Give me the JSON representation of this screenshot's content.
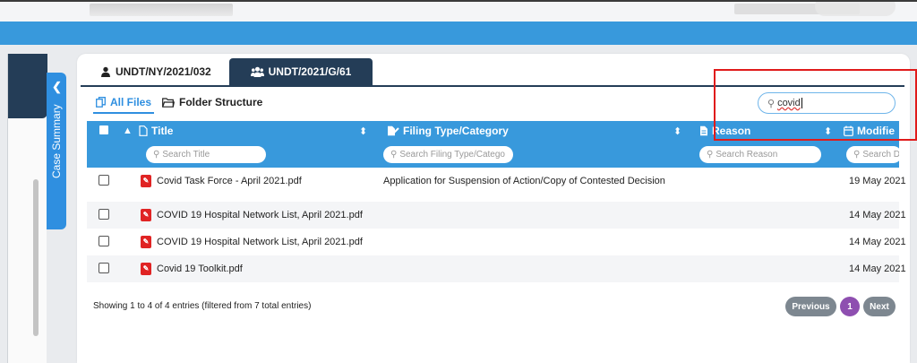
{
  "tabs": [
    {
      "label": "UNDT/NY/2021/032",
      "icon": "user-icon"
    },
    {
      "label": "UNDT/2021/G/61",
      "icon": "users-icon"
    }
  ],
  "side_panel": {
    "collapse_icon": "chevron-left-icon",
    "label": "Case Summary"
  },
  "subtabs": [
    {
      "label": "All Files",
      "icon": "copy-icon"
    },
    {
      "label": "Folder Structure",
      "icon": "folder-icon"
    }
  ],
  "global_search": {
    "value": "covid",
    "icon": "search-icon"
  },
  "table": {
    "columns": [
      {
        "label": "Title",
        "search_placeholder": "Search Title"
      },
      {
        "label": "Filing Type/Category",
        "search_placeholder": "Search Filing Type/Catego"
      },
      {
        "label": "Reason",
        "search_placeholder": "Search Reason"
      },
      {
        "label": "Modifie",
        "search_placeholder": "Search D"
      }
    ],
    "rows": [
      {
        "title": "Covid Task Force - April 2021.pdf",
        "filing": "Application for Suspension of Action/Copy of Contested Decision",
        "reason": "",
        "date": "19 May 2021"
      },
      {
        "title": "COVID 19 Hospital Network List, April 2021.pdf",
        "filing": "",
        "reason": "",
        "date": "14 May 2021"
      },
      {
        "title": "COVID 19 Hospital Network List, April 2021.pdf",
        "filing": "",
        "reason": "",
        "date": "14 May 2021"
      },
      {
        "title": "Covid 19 Toolkit.pdf",
        "filing": "",
        "reason": "",
        "date": "14 May 2021"
      }
    ]
  },
  "info_text": "Showing 1 to 4 of 4 entries (filtered from 7 total entries)",
  "pagination": {
    "previous": "Previous",
    "current": "1",
    "next": "Next"
  },
  "colors": {
    "accent_blue": "#3899dc",
    "navy": "#243d57",
    "highlight_red": "#e01b1b",
    "page_active": "#8e4fb0"
  }
}
